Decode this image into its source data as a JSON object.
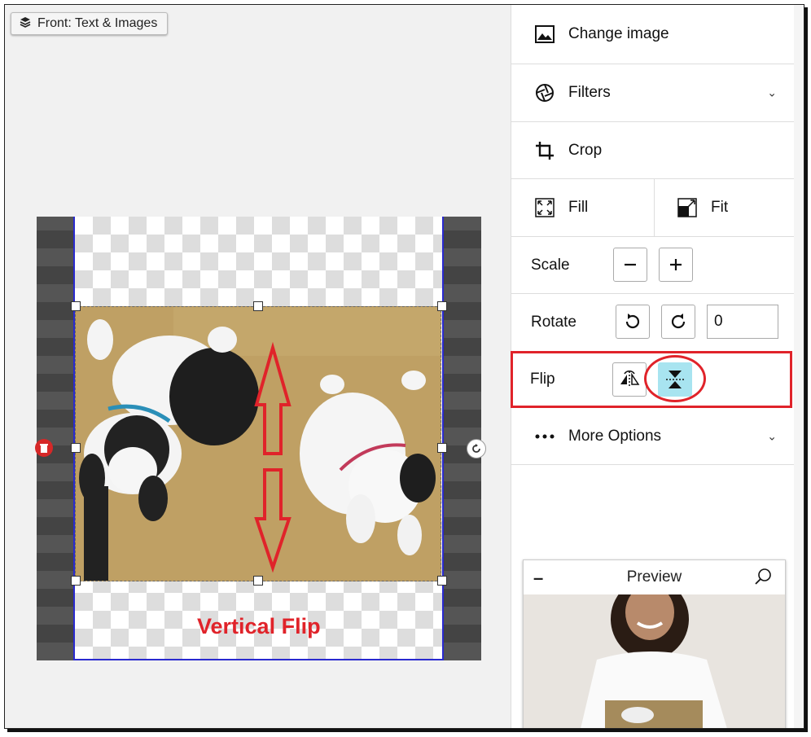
{
  "side_tab": {
    "label": "Front: Text & Images"
  },
  "annotation": {
    "caption": "Vertical Flip"
  },
  "panel": {
    "change_image": "Change image",
    "filters": "Filters",
    "crop": "Crop",
    "fill": "Fill",
    "fit": "Fit",
    "scale": "Scale",
    "rotate": "Rotate",
    "rotate_value": "0",
    "flip": "Flip",
    "more_options": "More Options"
  },
  "preview": {
    "title": "Preview"
  },
  "colors": {
    "annotation_red": "#e0232a",
    "flip_active": "#a8e4f0",
    "selection_blue": "#2a2ad0"
  }
}
